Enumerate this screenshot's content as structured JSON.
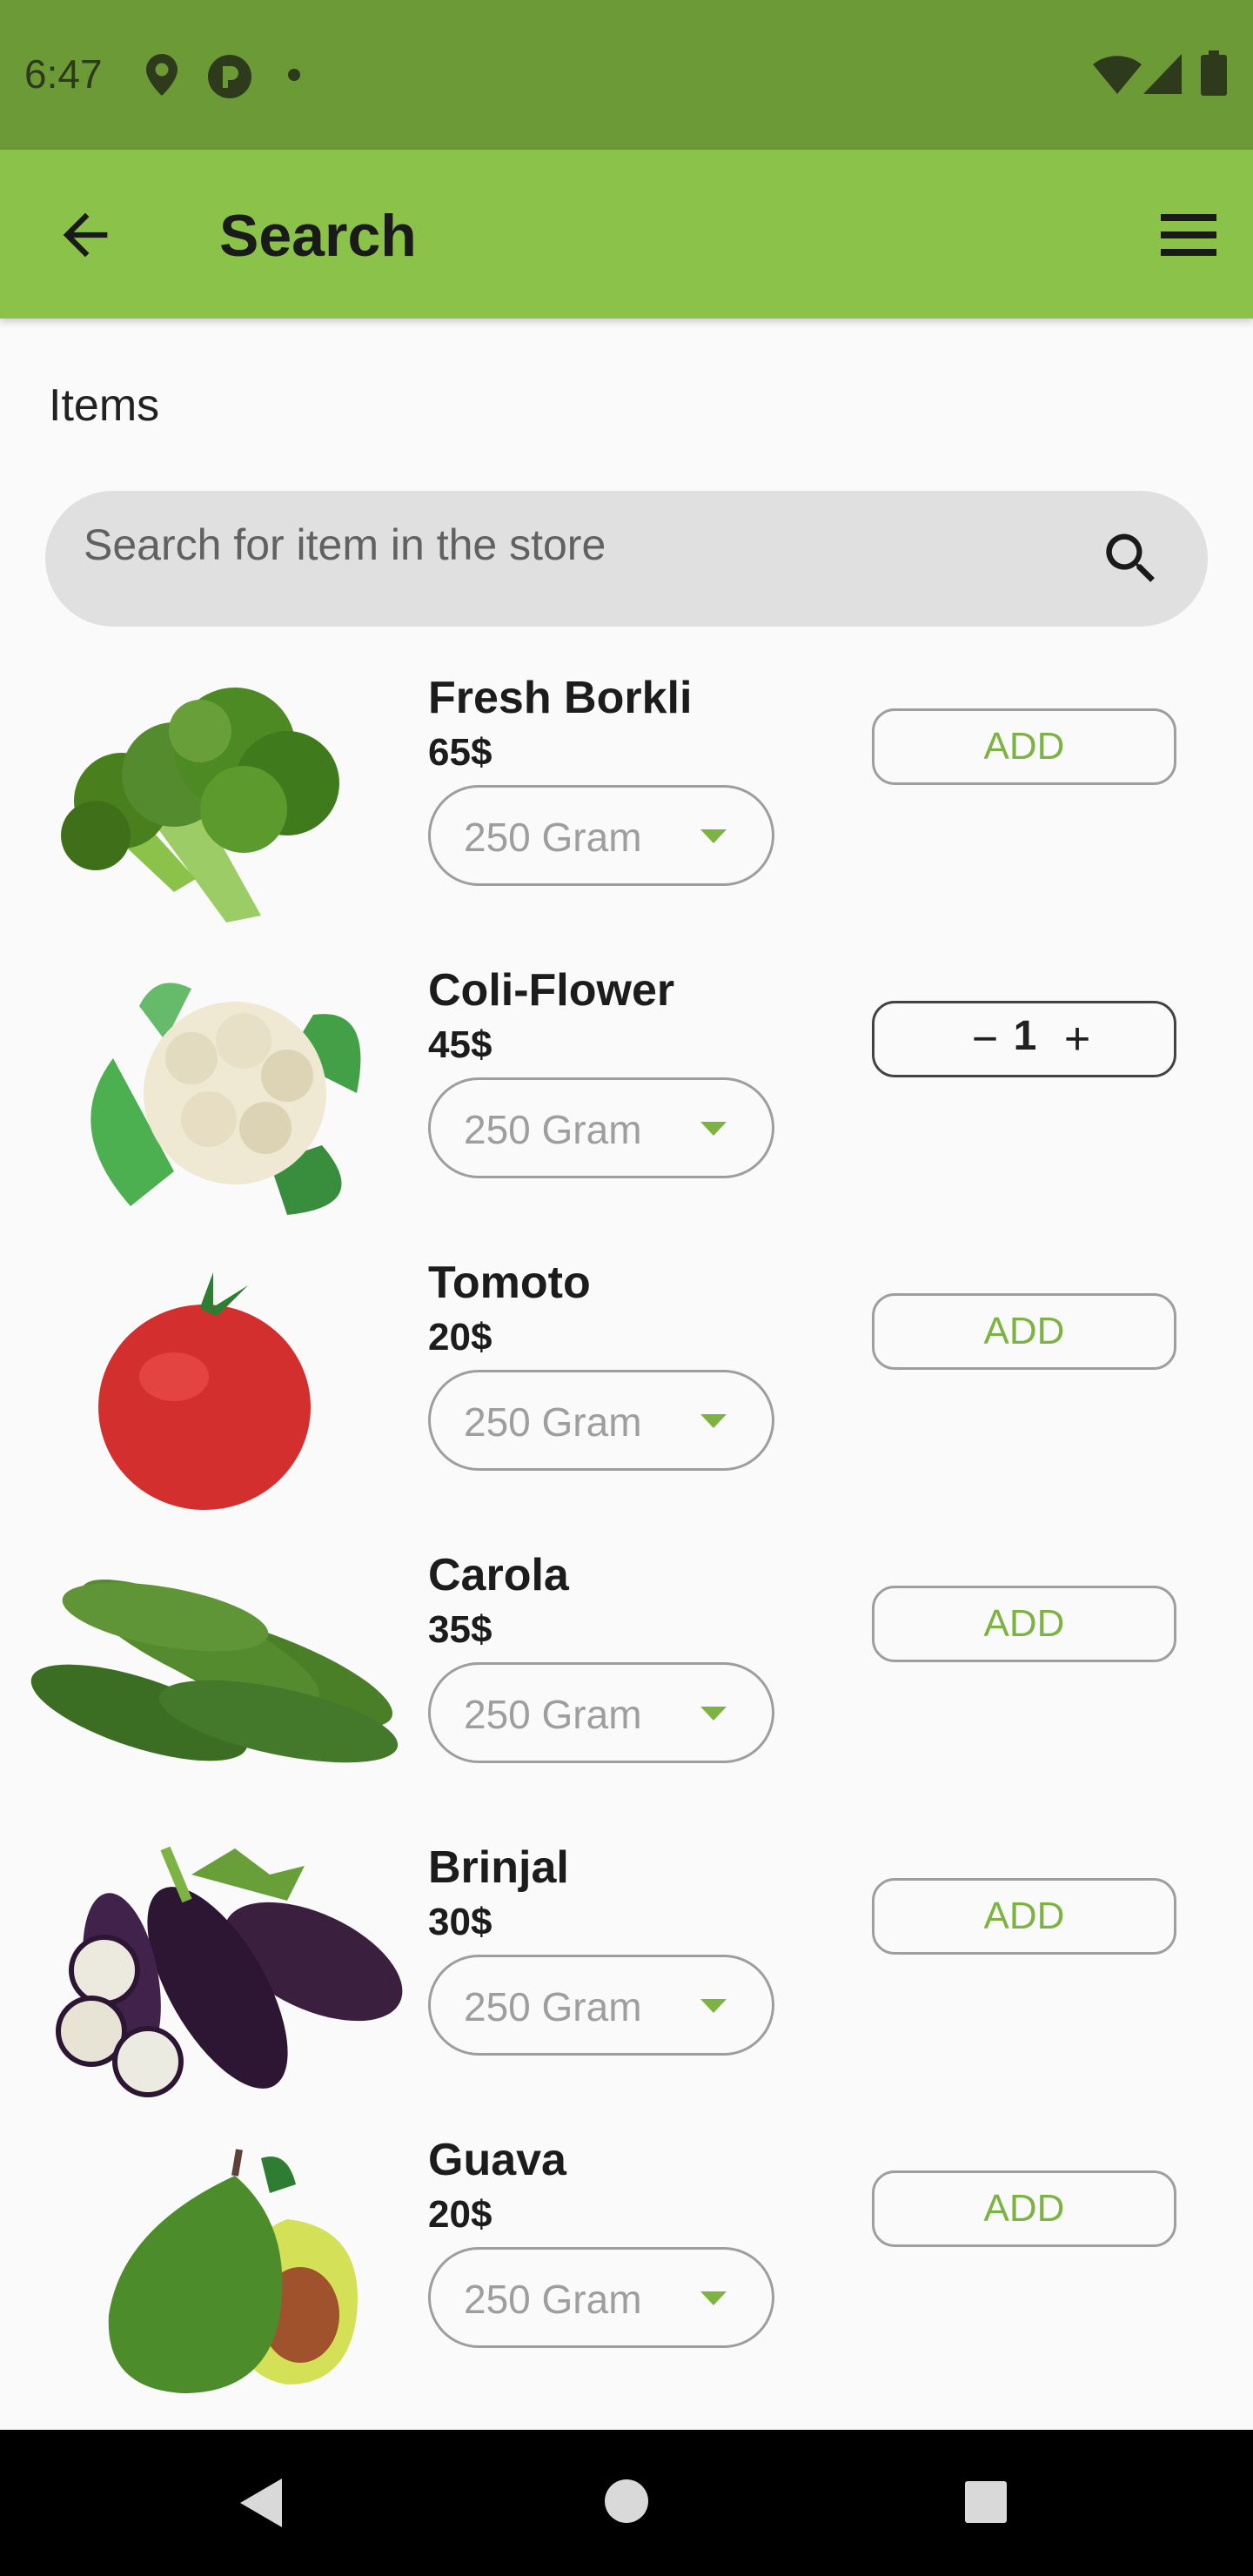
{
  "status_bar": {
    "time": "6:47"
  },
  "app_bar": {
    "title": "Search"
  },
  "section": {
    "title": "Items"
  },
  "search": {
    "placeholder": "Search for item in the store"
  },
  "items": [
    {
      "name": "Fresh Borkli",
      "price": "65$",
      "unit": "250 Gram",
      "action": "ADD",
      "image": "broccoli"
    },
    {
      "name": "Coli-Flower",
      "price": "45$",
      "unit": "250 Gram",
      "quantity": "1",
      "image": "cauliflower"
    },
    {
      "name": "Tomoto",
      "price": "20$",
      "unit": "250 Gram",
      "action": "ADD",
      "image": "tomato"
    },
    {
      "name": "Carola",
      "price": "35$",
      "unit": "250 Gram",
      "action": "ADD",
      "image": "bitter-gourd"
    },
    {
      "name": "Brinjal",
      "price": "30$",
      "unit": "250 Gram",
      "action": "ADD",
      "image": "eggplant"
    },
    {
      "name": "Guava",
      "price": "20$",
      "unit": "250 Gram",
      "action": "ADD",
      "image": "avocado"
    }
  ],
  "stepper_symbols": {
    "minus": "−",
    "plus": "+"
  },
  "icons": [
    "location-icon",
    "app-badge-icon",
    "wifi-icon",
    "signal-icon",
    "battery-icon",
    "back-arrow-icon",
    "menu-icon",
    "search-icon",
    "nav-back-icon",
    "nav-home-icon",
    "nav-recents-icon"
  ],
  "colors": {
    "status_bar": "#6b9a36",
    "app_bar": "#8bc34a",
    "accent": "#7cb342",
    "background": "#fafafa"
  }
}
